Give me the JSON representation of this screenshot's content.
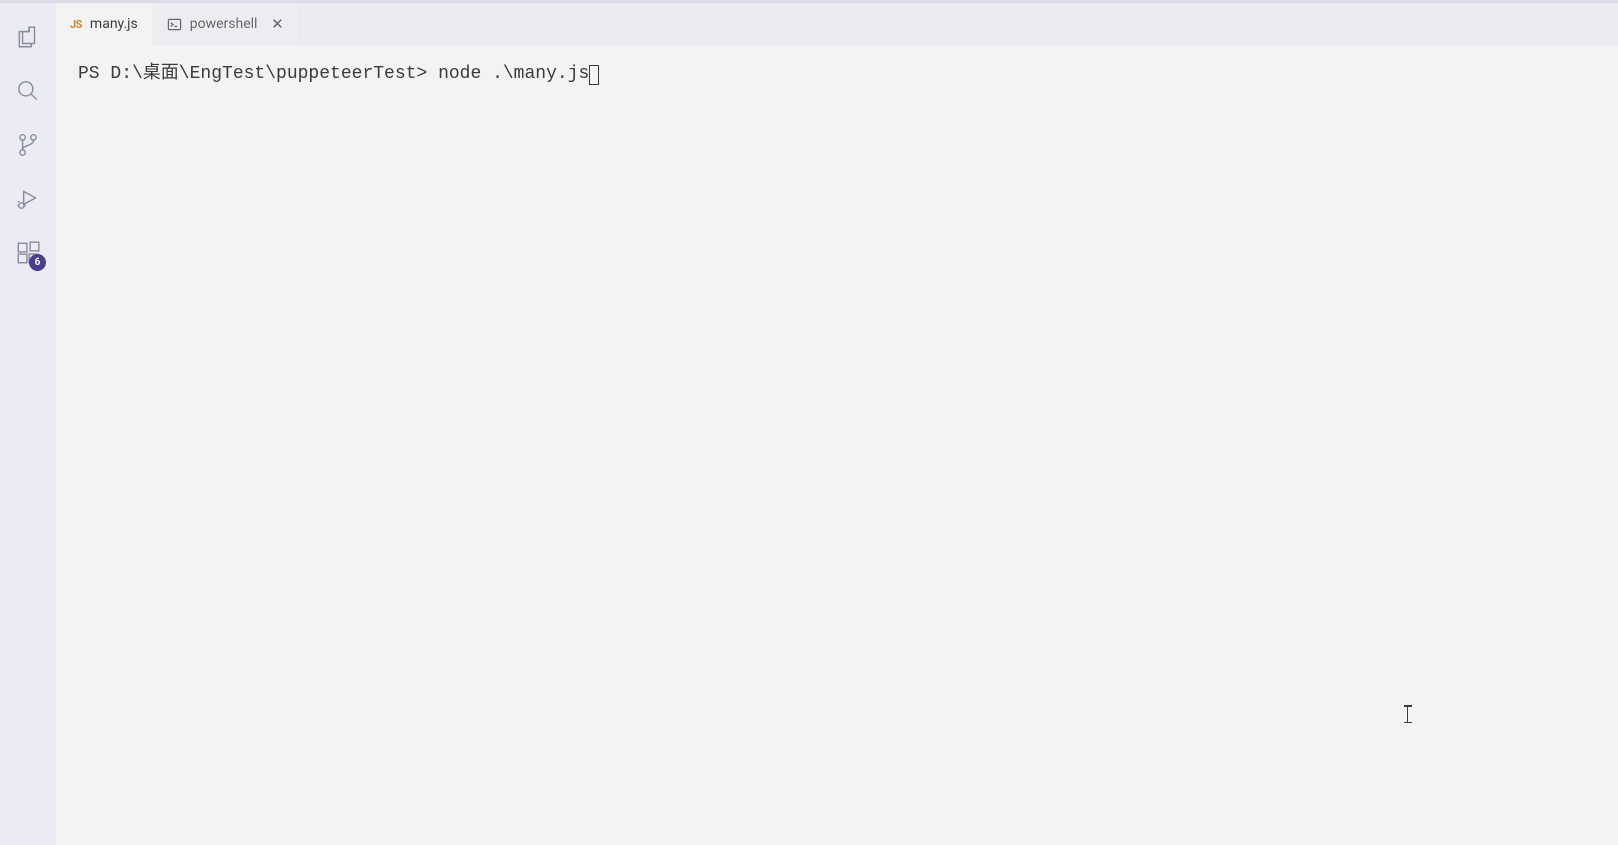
{
  "tabs": [
    {
      "label": "many.js",
      "icon": "js",
      "active": true,
      "closable": false
    },
    {
      "label": "powershell",
      "icon": "terminal",
      "active": false,
      "closable": true
    }
  ],
  "terminal": {
    "prompt": "PS D:\\桌面\\EngTest\\puppeteerTest> ",
    "command": "node .\\many.js"
  },
  "activity_bar": {
    "extensions_badge": "6"
  }
}
